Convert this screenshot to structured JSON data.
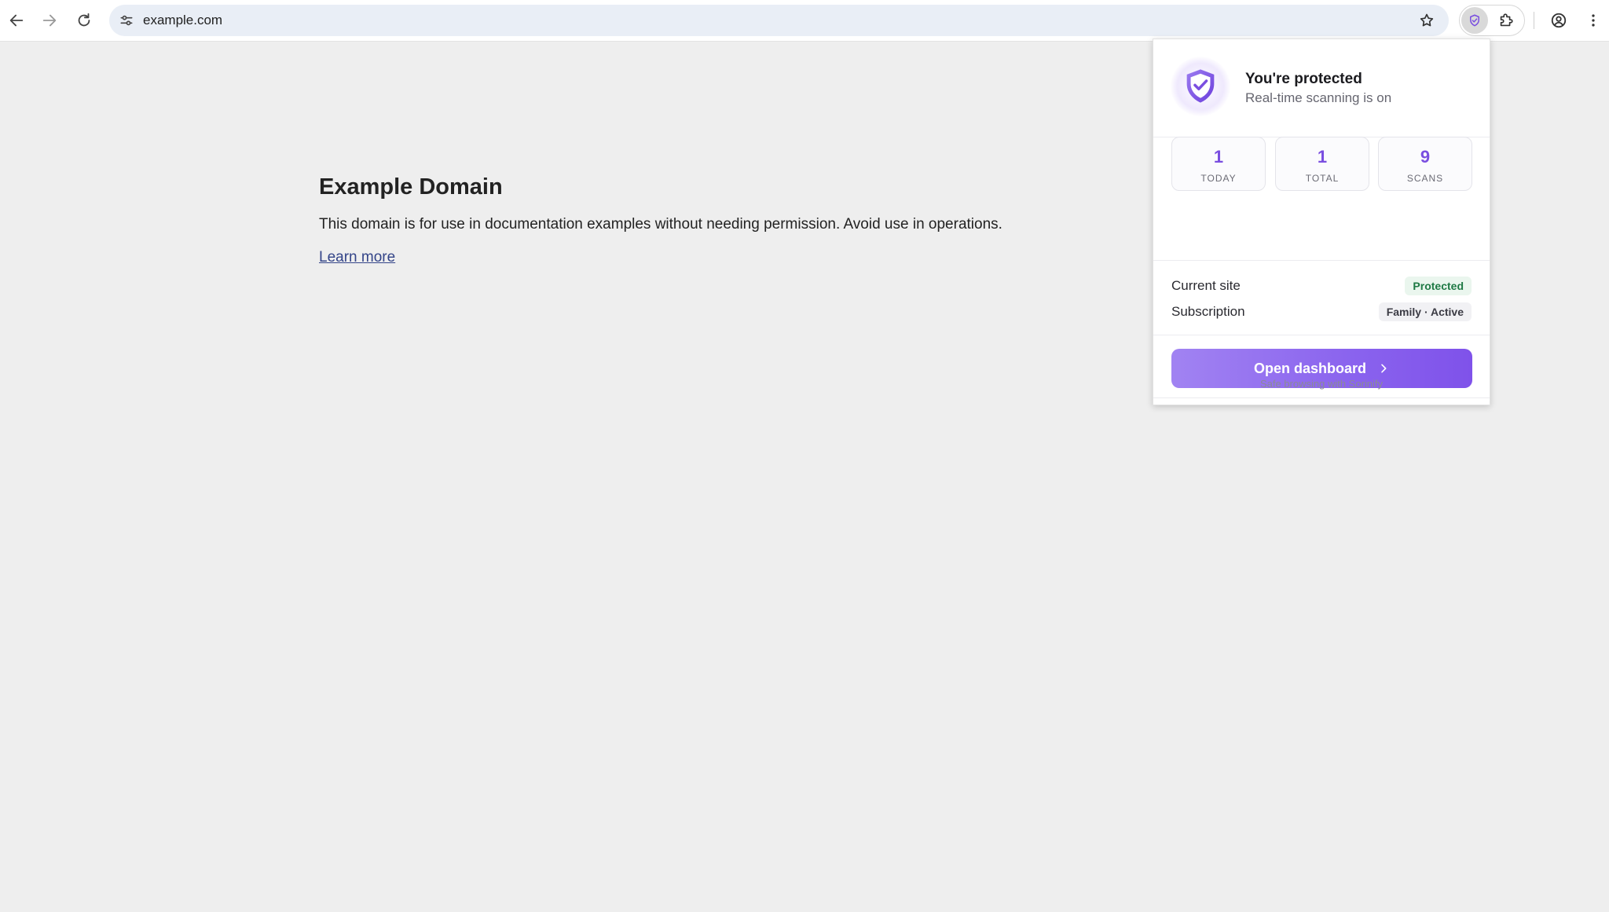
{
  "browser": {
    "url": "example.com",
    "icons": {
      "back": "back-arrow-icon",
      "forward": "forward-arrow-icon",
      "reload": "reload-icon",
      "site_info": "tune-icon",
      "bookmark": "star-icon",
      "extension": "shield-check-icon",
      "extensions_menu": "puzzle-icon",
      "profile": "profile-icon",
      "menu": "kebab-menu-icon"
    }
  },
  "page": {
    "title": "Example Domain",
    "body": "This domain is for use in documentation examples without needing permission. Avoid use in operations.",
    "link": "Learn more"
  },
  "popup": {
    "title": "You're protected",
    "subtitle": "Real-time scanning is on",
    "stats": [
      {
        "value": "1",
        "label": "TODAY"
      },
      {
        "value": "1",
        "label": "TOTAL"
      },
      {
        "value": "9",
        "label": "SCANS"
      }
    ],
    "current_site_label": "Current site",
    "current_site_status": "Protected",
    "subscription_label": "Subscription",
    "subscription_status": "Family · Active",
    "cta_label": "Open dashboard",
    "footer": "Safe browsing with Sorinify",
    "colors": {
      "accent": "#7a4ee0",
      "cta_start": "#a183f2",
      "cta_end": "#7f52ea",
      "status_green": "#1f7a45"
    }
  }
}
